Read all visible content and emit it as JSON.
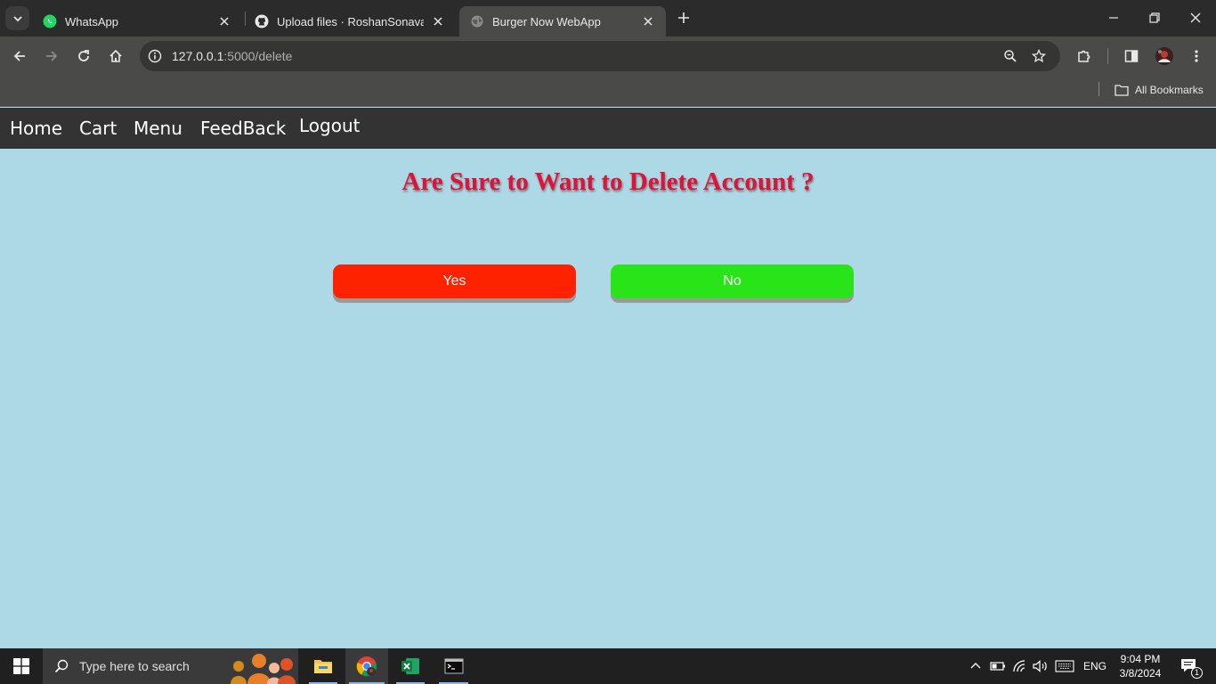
{
  "browser": {
    "tabs": [
      {
        "title": "WhatsApp",
        "icon": "whatsapp-icon"
      },
      {
        "title": "Upload files · RoshanSonavane/",
        "icon": "github-icon"
      },
      {
        "title": "Burger Now WebApp",
        "icon": "globe-icon"
      }
    ],
    "url_host": "127.0.0.1",
    "url_path": ":5000/delete",
    "bookmarks_label": "All Bookmarks"
  },
  "nav": {
    "home": "Home",
    "cart": "Cart",
    "menu": "Menu",
    "feedback": "FeedBack",
    "logout": "Logout"
  },
  "main": {
    "heading": "Are Sure to Want to Delete Account ?",
    "yes_label": "Yes",
    "no_label": "No"
  },
  "colors": {
    "page_bg": "#add8e6",
    "heading": "#dc143c",
    "yes_button": "#ff2200",
    "no_button": "#2ae41a",
    "navbar": "#333333"
  },
  "taskbar": {
    "search_placeholder": "Type here to search",
    "language": "ENG",
    "time": "9:04 PM",
    "date": "3/8/2024",
    "notifications": "1"
  }
}
